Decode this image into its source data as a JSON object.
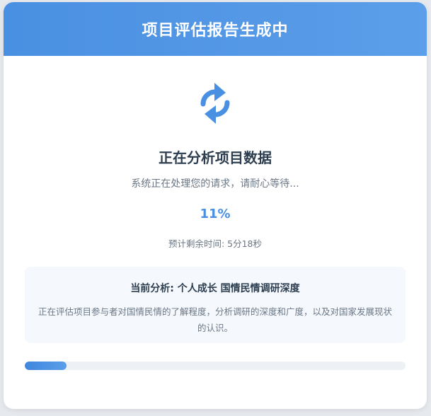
{
  "header": {
    "title": "项目评估报告生成中"
  },
  "status": {
    "icon": "sync-icon",
    "title": "正在分析项目数据",
    "subtitle": "系统正在处理您的请求，请耐心等待...",
    "percent_text": "11%",
    "progress": 0.11,
    "eta": "预计剩余时间: 5分18秒"
  },
  "analysis": {
    "title": "当前分析: 个人成长 国情民情调研深度",
    "description": "正在评估项目参与者对国情民情的了解程度，分析调研的深度和广度，以及对国家发展现状的认识。"
  },
  "colors": {
    "accent": "#4a90e2",
    "text_dark": "#2c3e50",
    "text_muted": "#6b7785",
    "panel_bg": "#f5f8fd"
  }
}
